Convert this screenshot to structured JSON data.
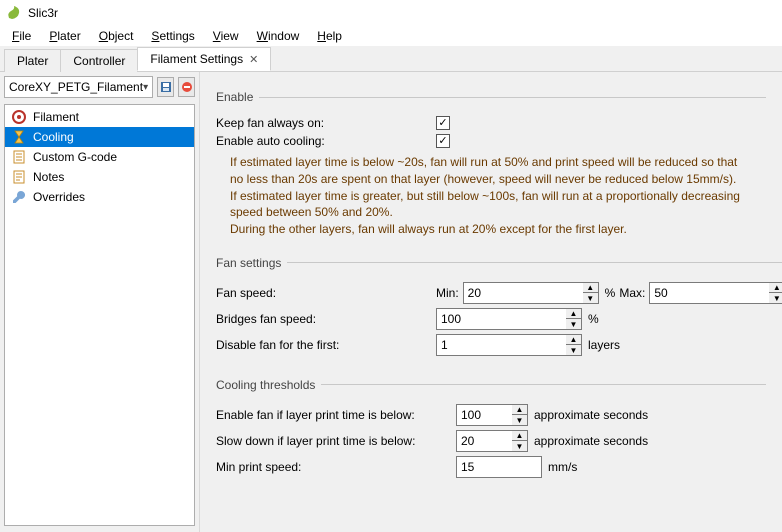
{
  "app": {
    "title": "Slic3r"
  },
  "menu": {
    "file": "File",
    "plater": "Plater",
    "object": "Object",
    "settings": "Settings",
    "view": "View",
    "window": "Window",
    "help": "Help"
  },
  "tabs": {
    "plater": "Plater",
    "controller": "Controller",
    "filament": "Filament Settings"
  },
  "preset": {
    "name": "CoreXY_PETG_Filament"
  },
  "tree": {
    "filament": "Filament",
    "cooling": "Cooling",
    "gcode": "Custom G-code",
    "notes": "Notes",
    "overrides": "Overrides"
  },
  "enable": {
    "legend": "Enable",
    "keep_fan_label": "Keep fan always on:",
    "auto_cooling_label": "Enable auto cooling:",
    "desc1": "If estimated layer time is below ~20s, fan will run at 50% and print speed will be reduced so that no less than 20s are spent on that layer (however, speed will never be reduced below 15mm/s).",
    "desc2": "If estimated layer time is greater, but still below ~100s, fan will run at a proportionally decreasing speed between 50% and 20%.",
    "desc3": "During the other layers, fan will always run at 20% except for the first layer."
  },
  "fan": {
    "legend": "Fan settings",
    "speed_label": "Fan speed:",
    "min_label": "Min:",
    "min_value": "20",
    "min_unit": "%",
    "max_label": "Max:",
    "max_value": "50",
    "max_unit": "%",
    "bridges_label": "Bridges fan speed:",
    "bridges_value": "100",
    "bridges_unit": "%",
    "disable_first_label": "Disable fan for the first:",
    "disable_first_value": "1",
    "disable_first_unit": "layers"
  },
  "cool": {
    "legend": "Cooling thresholds",
    "enable_fan_label": "Enable fan if layer print time is below:",
    "enable_fan_value": "100",
    "enable_fan_unit": "approximate seconds",
    "slow_label": "Slow down if layer print time is below:",
    "slow_value": "20",
    "slow_unit": "approximate seconds",
    "min_speed_label": "Min print speed:",
    "min_speed_value": "15",
    "min_speed_unit": "mm/s"
  }
}
